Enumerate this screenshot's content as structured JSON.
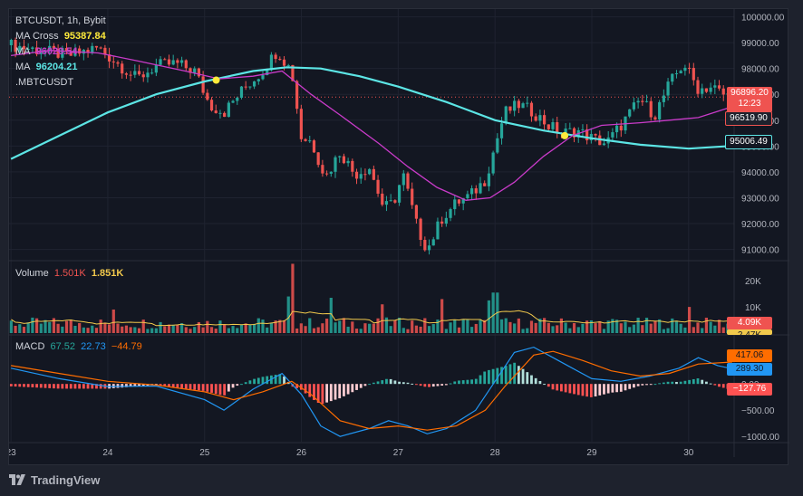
{
  "header": {
    "symbol": "BTCUSDT, 1h, Bybit",
    "ma_cross_label": "MA Cross",
    "ma_cross_value": "95387.84",
    "ma1_label": "MA",
    "ma1_value": "96020.54",
    "ma2_label": "MA",
    "ma2_value": "96204.21",
    "compare_label": ".MBTCUSDT"
  },
  "volume_legend": {
    "label": "Volume",
    "value1": "1.501K",
    "value2": "1.851K"
  },
  "macd_legend": {
    "label": "MACD",
    "v1": "67.52",
    "v2": "22.73",
    "v3": "−44.79"
  },
  "price_axis": {
    "ticks": [
      "100000.00",
      "99000.00",
      "98000.00",
      "97000.00",
      "96000.00",
      "95000.00",
      "94000.00",
      "93000.00",
      "92000.00",
      "91000.00"
    ],
    "last_price": "96896.20",
    "countdown": "12:23",
    "ma_fast_tag": "96519.90",
    "ma_slow_tag": "95006.49"
  },
  "volume_axis": {
    "ticks": [
      "20K",
      "10K"
    ],
    "tag1": "4.09K",
    "tag2": "2.47K"
  },
  "macd_axis": {
    "ticks": [
      "0.00",
      "−500.00",
      "−1000.00"
    ],
    "tag_signal": "417.06",
    "tag_macd": "289.30",
    "tag_hist": "−127.76"
  },
  "time_axis": {
    "labels": [
      "23",
      "24",
      "25",
      "26",
      "27",
      "28",
      "29",
      "30"
    ]
  },
  "footer": {
    "brand": "TradingView"
  },
  "colors": {
    "background": "#131722",
    "frame": "#1e222d",
    "up": "#26a69a",
    "down": "#ef5350",
    "ma_slow": "#5ce5e5",
    "ma_fast": "#c93bc9",
    "cross_marker": "#ffeb3b",
    "volume_ma": "#f2c94c",
    "macd_line": "#2196f3",
    "signal_line": "#ff6d00",
    "hist_up_strong": "#26a69a",
    "hist_up_weak": "#b2dfdb",
    "hist_down_strong": "#ff5252",
    "hist_down_weak": "#ffcdd2"
  },
  "chart_data": {
    "type": "candlestick",
    "symbol": "BTCUSDT",
    "interval": "1h",
    "exchange": "Bybit",
    "ylim": [
      90600,
      100300
    ],
    "x_days": [
      "23",
      "24",
      "25",
      "26",
      "27",
      "28",
      "29",
      "30"
    ],
    "close_path": [
      {
        "day": 23.0,
        "price": 98900
      },
      {
        "day": 23.3,
        "price": 98700
      },
      {
        "day": 23.6,
        "price": 98500
      },
      {
        "day": 23.9,
        "price": 98800
      },
      {
        "day": 24.1,
        "price": 98200
      },
      {
        "day": 24.3,
        "price": 97600
      },
      {
        "day": 24.5,
        "price": 98100
      },
      {
        "day": 24.7,
        "price": 98200
      },
      {
        "day": 24.9,
        "price": 97900
      },
      {
        "day": 25.05,
        "price": 96600
      },
      {
        "day": 25.2,
        "price": 96300
      },
      {
        "day": 25.4,
        "price": 97200
      },
      {
        "day": 25.6,
        "price": 97900
      },
      {
        "day": 25.75,
        "price": 98700
      },
      {
        "day": 25.9,
        "price": 97900
      },
      {
        "day": 26.0,
        "price": 95300
      },
      {
        "day": 26.1,
        "price": 95200
      },
      {
        "day": 26.25,
        "price": 93800
      },
      {
        "day": 26.4,
        "price": 94800
      },
      {
        "day": 26.55,
        "price": 93900
      },
      {
        "day": 26.7,
        "price": 94200
      },
      {
        "day": 26.85,
        "price": 92600
      },
      {
        "day": 26.95,
        "price": 92800
      },
      {
        "day": 27.05,
        "price": 93900
      },
      {
        "day": 27.2,
        "price": 91800
      },
      {
        "day": 27.3,
        "price": 91000
      },
      {
        "day": 27.45,
        "price": 92200
      },
      {
        "day": 27.6,
        "price": 92800
      },
      {
        "day": 27.75,
        "price": 93100
      },
      {
        "day": 27.9,
        "price": 93700
      },
      {
        "day": 28.0,
        "price": 95000
      },
      {
        "day": 28.1,
        "price": 96300
      },
      {
        "day": 28.25,
        "price": 96600
      },
      {
        "day": 28.4,
        "price": 96300
      },
      {
        "day": 28.55,
        "price": 95800
      },
      {
        "day": 28.7,
        "price": 95500
      },
      {
        "day": 28.85,
        "price": 95600
      },
      {
        "day": 29.0,
        "price": 95300
      },
      {
        "day": 29.15,
        "price": 95100
      },
      {
        "day": 29.3,
        "price": 95800
      },
      {
        "day": 29.5,
        "price": 96800
      },
      {
        "day": 29.65,
        "price": 96200
      },
      {
        "day": 29.8,
        "price": 97400
      },
      {
        "day": 29.95,
        "price": 98200
      },
      {
        "day": 30.1,
        "price": 97200
      },
      {
        "day": 30.25,
        "price": 97300
      },
      {
        "day": 30.35,
        "price": 97000
      },
      {
        "day": 30.45,
        "price": 96896
      }
    ],
    "ma_slow_path": [
      {
        "day": 23.0,
        "price": 94500
      },
      {
        "day": 23.5,
        "price": 95400
      },
      {
        "day": 24.0,
        "price": 96300
      },
      {
        "day": 24.5,
        "price": 97000
      },
      {
        "day": 25.0,
        "price": 97500
      },
      {
        "day": 25.5,
        "price": 97900
      },
      {
        "day": 25.85,
        "price": 98050
      },
      {
        "day": 26.2,
        "price": 98000
      },
      {
        "day": 26.6,
        "price": 97700
      },
      {
        "day": 27.0,
        "price": 97300
      },
      {
        "day": 27.5,
        "price": 96700
      },
      {
        "day": 28.0,
        "price": 96000
      },
      {
        "day": 28.5,
        "price": 95600
      },
      {
        "day": 29.0,
        "price": 95300
      },
      {
        "day": 29.5,
        "price": 95050
      },
      {
        "day": 30.0,
        "price": 94900
      },
      {
        "day": 30.45,
        "price": 95006
      }
    ],
    "ma_fast_path": [
      {
        "day": 23.0,
        "price": 98500
      },
      {
        "day": 23.4,
        "price": 98700
      },
      {
        "day": 23.9,
        "price": 98600
      },
      {
        "day": 24.3,
        "price": 98300
      },
      {
        "day": 24.8,
        "price": 97900
      },
      {
        "day": 25.15,
        "price": 97600
      },
      {
        "day": 25.5,
        "price": 97700
      },
      {
        "day": 25.8,
        "price": 97900
      },
      {
        "day": 26.1,
        "price": 97000
      },
      {
        "day": 26.4,
        "price": 96200
      },
      {
        "day": 26.8,
        "price": 95100
      },
      {
        "day": 27.1,
        "price": 94200
      },
      {
        "day": 27.4,
        "price": 93400
      },
      {
        "day": 27.7,
        "price": 92900
      },
      {
        "day": 27.95,
        "price": 93000
      },
      {
        "day": 28.2,
        "price": 93600
      },
      {
        "day": 28.5,
        "price": 94600
      },
      {
        "day": 28.8,
        "price": 95400
      },
      {
        "day": 29.1,
        "price": 95800
      },
      {
        "day": 29.5,
        "price": 95900
      },
      {
        "day": 29.8,
        "price": 96000
      },
      {
        "day": 30.1,
        "price": 96100
      },
      {
        "day": 30.45,
        "price": 96520
      }
    ],
    "cross_markers": [
      {
        "day": 25.12,
        "price": 97550
      },
      {
        "day": 28.72,
        "price": 95400
      }
    ],
    "volume": {
      "ylim": [
        0,
        27000
      ],
      "spikes": [
        {
          "day": 25.9,
          "value": 26500,
          "dir": "up"
        },
        {
          "day": 25.85,
          "value": 14000,
          "dir": "down"
        },
        {
          "day": 26.3,
          "value": 13500,
          "dir": "down"
        },
        {
          "day": 27.45,
          "value": 13000,
          "dir": "up"
        },
        {
          "day": 28.0,
          "value": 15500,
          "dir": "up"
        },
        {
          "day": 30.0,
          "value": 10000,
          "dir": "down"
        },
        {
          "day": 24.05,
          "value": 9000,
          "dir": "down"
        },
        {
          "day": 26.85,
          "value": 11000,
          "dir": "down"
        },
        {
          "day": 27.95,
          "value": 12500,
          "dir": "down"
        }
      ],
      "last": 4090,
      "ma_last": 2470
    },
    "macd": {
      "ylim": [
        -1100,
        900
      ],
      "macd_path": [
        {
          "day": 23.0,
          "v": 300
        },
        {
          "day": 23.5,
          "v": 100
        },
        {
          "day": 24.0,
          "v": -50
        },
        {
          "day": 24.5,
          "v": -40
        },
        {
          "day": 25.0,
          "v": -300
        },
        {
          "day": 25.2,
          "v": -500
        },
        {
          "day": 25.5,
          "v": -100
        },
        {
          "day": 25.8,
          "v": 200
        },
        {
          "day": 26.0,
          "v": -200
        },
        {
          "day": 26.2,
          "v": -800
        },
        {
          "day": 26.4,
          "v": -1000
        },
        {
          "day": 26.7,
          "v": -850
        },
        {
          "day": 26.9,
          "v": -700
        },
        {
          "day": 27.1,
          "v": -800
        },
        {
          "day": 27.3,
          "v": -950
        },
        {
          "day": 27.5,
          "v": -850
        },
        {
          "day": 27.8,
          "v": -500
        },
        {
          "day": 28.0,
          "v": 50
        },
        {
          "day": 28.2,
          "v": 600
        },
        {
          "day": 28.4,
          "v": 700
        },
        {
          "day": 28.6,
          "v": 500
        },
        {
          "day": 28.8,
          "v": 300
        },
        {
          "day": 29.0,
          "v": 100
        },
        {
          "day": 29.3,
          "v": 50
        },
        {
          "day": 29.6,
          "v": 150
        },
        {
          "day": 29.9,
          "v": 300
        },
        {
          "day": 30.1,
          "v": 500
        },
        {
          "day": 30.3,
          "v": 350
        },
        {
          "day": 30.45,
          "v": 289
        }
      ],
      "signal_path": [
        {
          "day": 23.0,
          "v": 350
        },
        {
          "day": 23.5,
          "v": 200
        },
        {
          "day": 24.0,
          "v": 50
        },
        {
          "day": 24.5,
          "v": -20
        },
        {
          "day": 25.0,
          "v": -150
        },
        {
          "day": 25.3,
          "v": -300
        },
        {
          "day": 25.6,
          "v": -150
        },
        {
          "day": 25.9,
          "v": 50
        },
        {
          "day": 26.1,
          "v": -200
        },
        {
          "day": 26.4,
          "v": -700
        },
        {
          "day": 26.7,
          "v": -850
        },
        {
          "day": 27.0,
          "v": -800
        },
        {
          "day": 27.3,
          "v": -880
        },
        {
          "day": 27.6,
          "v": -800
        },
        {
          "day": 27.9,
          "v": -500
        },
        {
          "day": 28.1,
          "v": -50
        },
        {
          "day": 28.4,
          "v": 550
        },
        {
          "day": 28.6,
          "v": 620
        },
        {
          "day": 28.9,
          "v": 450
        },
        {
          "day": 29.2,
          "v": 250
        },
        {
          "day": 29.5,
          "v": 150
        },
        {
          "day": 29.8,
          "v": 200
        },
        {
          "day": 30.1,
          "v": 380
        },
        {
          "day": 30.45,
          "v": 417
        }
      ],
      "last_hist": -127.76
    }
  }
}
